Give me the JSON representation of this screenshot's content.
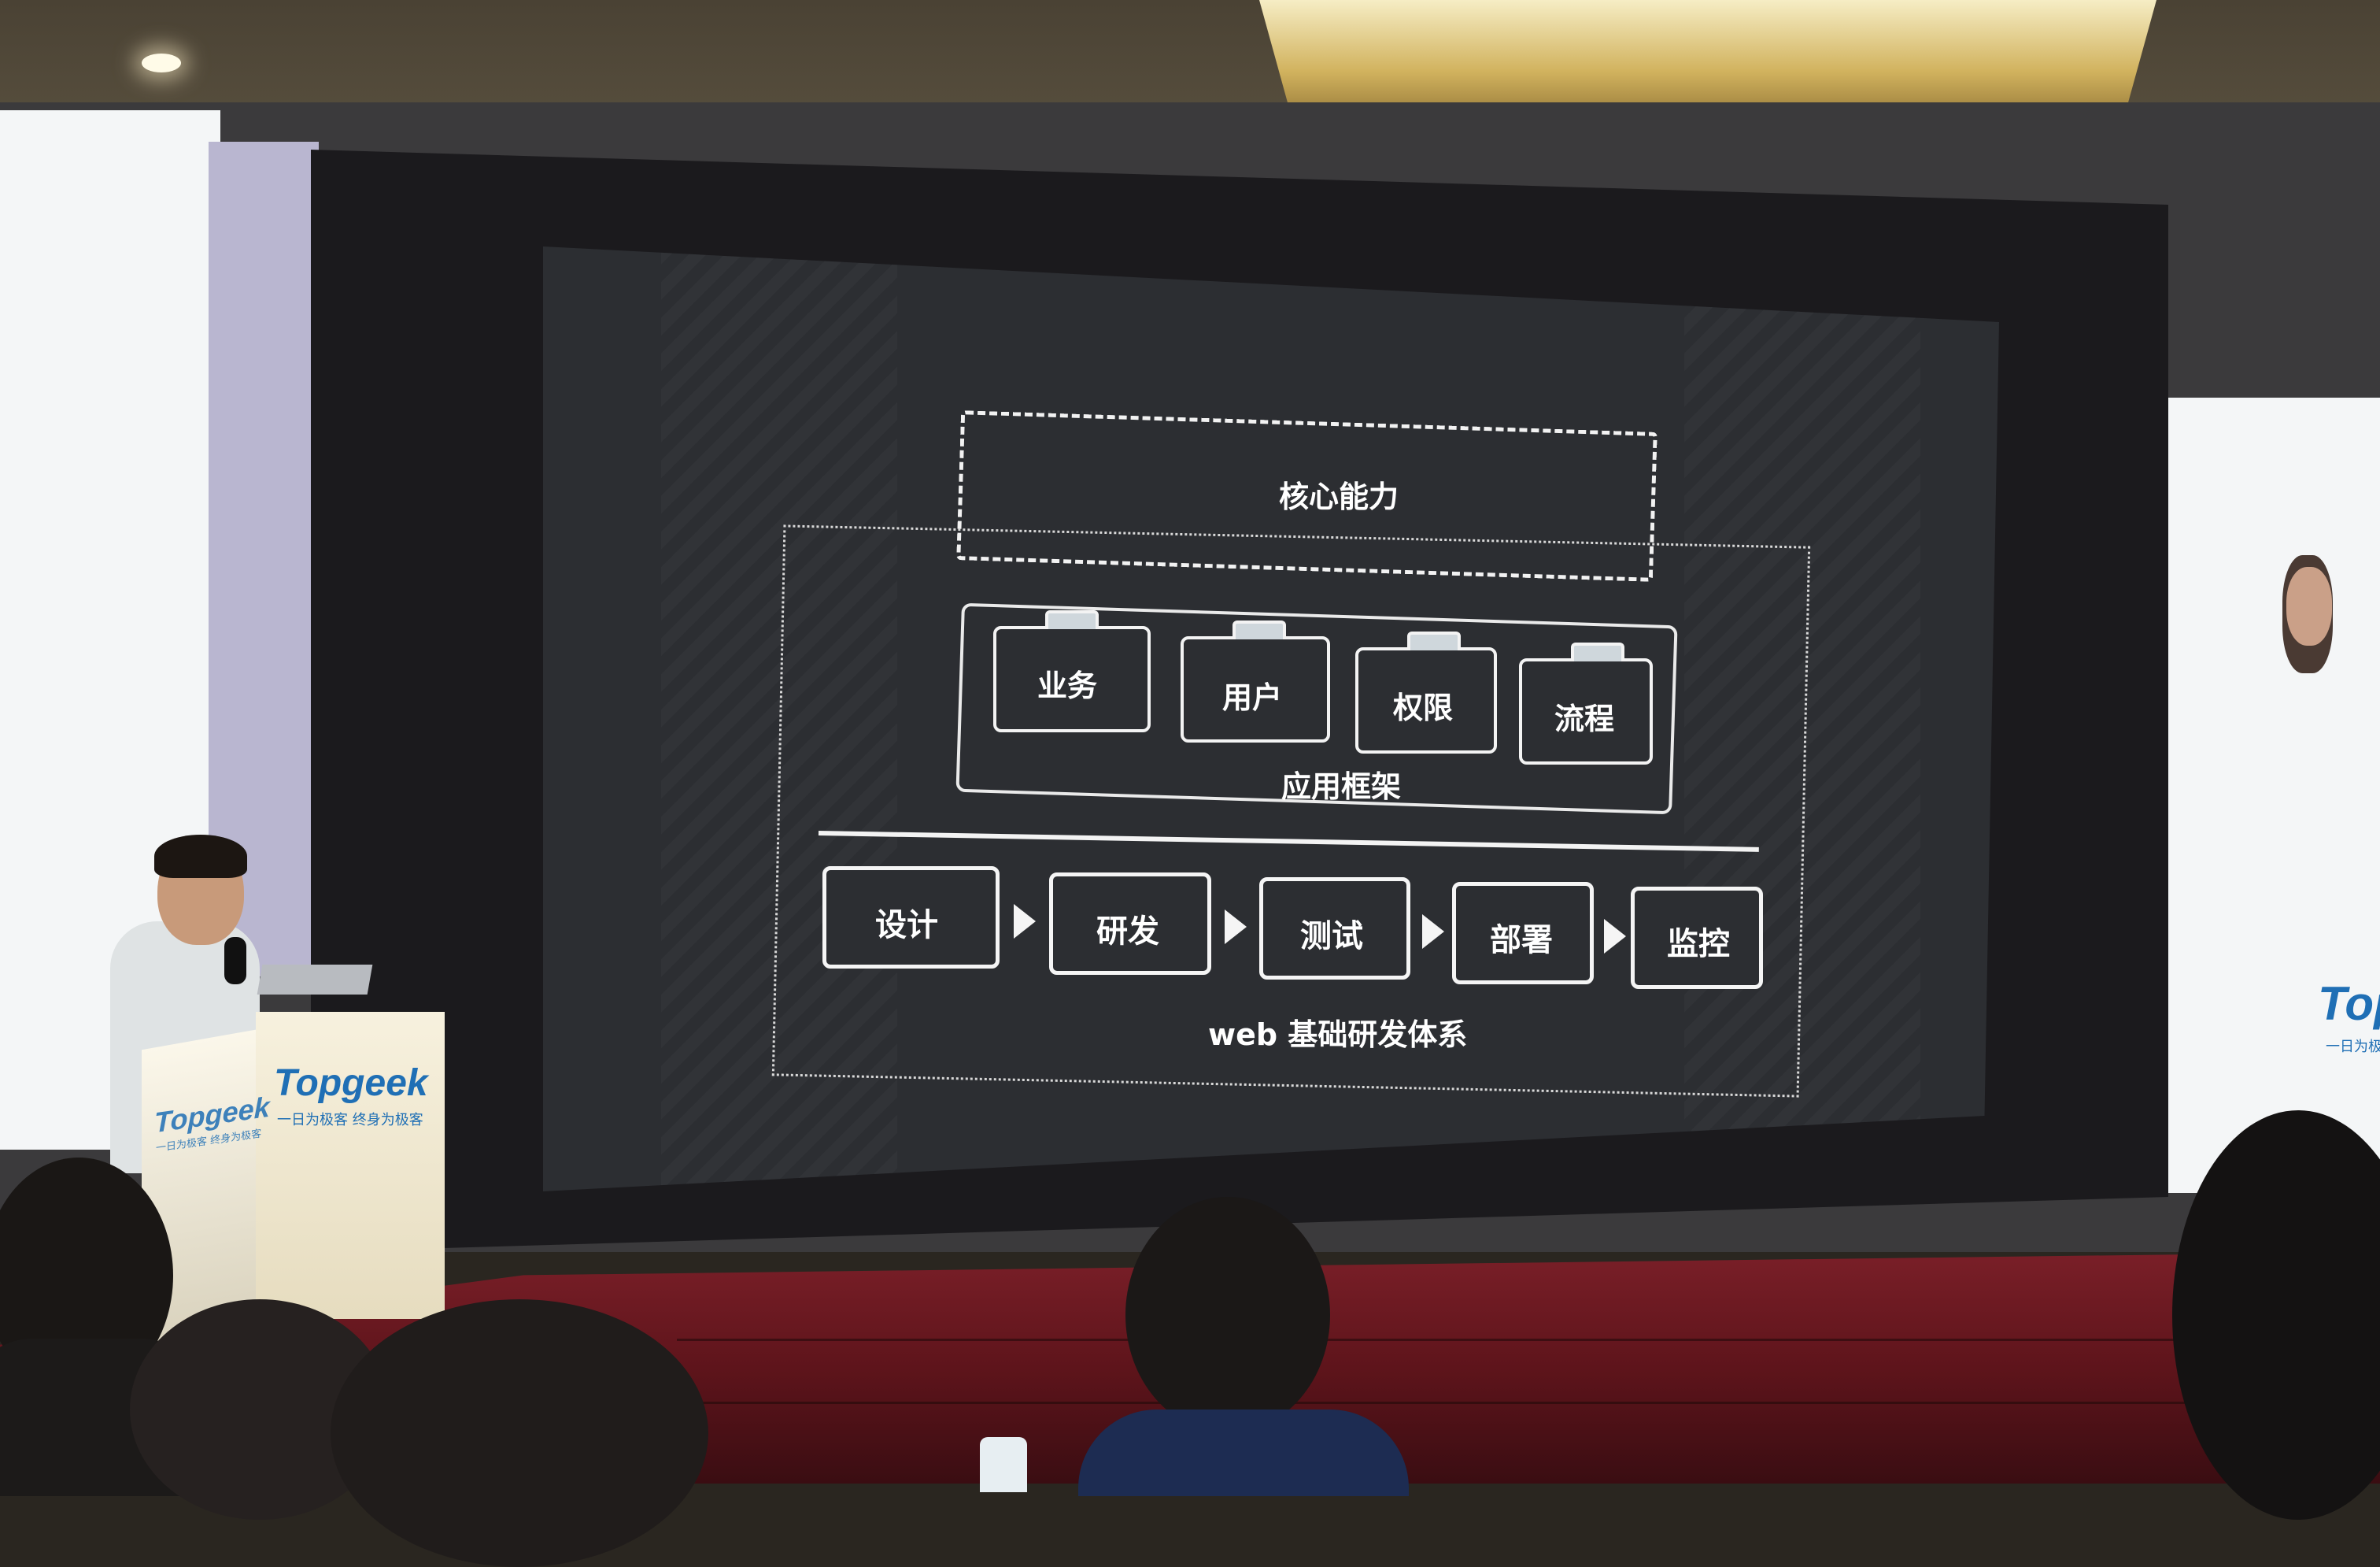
{
  "slide": {
    "core_label": "核心能力",
    "modules": [
      "业务",
      "用户",
      "权限",
      "流程"
    ],
    "framework_label": "应用框架",
    "pipeline": [
      "设计",
      "研发",
      "测试",
      "部署",
      "监控"
    ],
    "system_label": "web 基础研发体系"
  },
  "podium": {
    "brand": "Topgeek",
    "slogan": "一日为极客 终身为极客"
  },
  "side_screen": {
    "brand_partial": "Topg",
    "slogan_partial": "一日为极"
  },
  "colors": {
    "slide_bg": "#2c2e32",
    "slide_line": "#f3f3f3",
    "stage_red": "#7a1f28",
    "brand_blue": "#1f6fb5",
    "podium": "#f0e6c8"
  }
}
